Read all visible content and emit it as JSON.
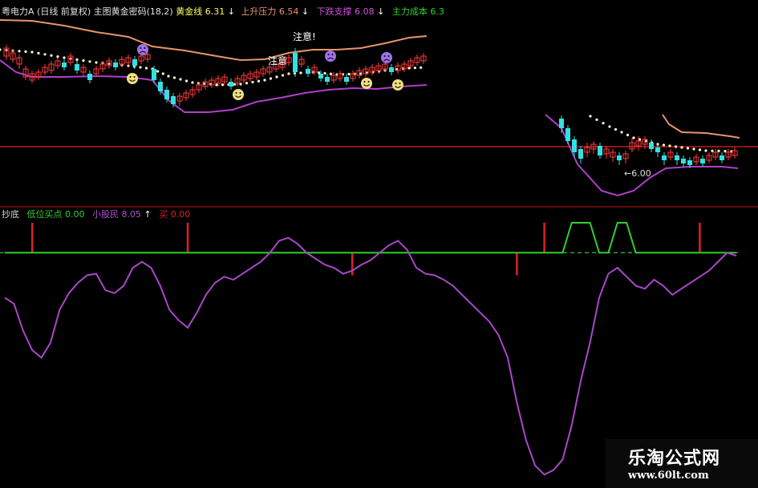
{
  "colors": {
    "background": "#000000",
    "bull_candle": "#ff3b3b",
    "bear_candle": "#33e0e0",
    "upper_band": "#e8956a",
    "lower_band": "#b040c8",
    "mid_dots": "#ffffcc",
    "separator": "#c01818",
    "buy_bar": "#e02020",
    "small_shareholder": "#a848c8",
    "low_buy_line": "#30d030",
    "baseline_dash": "#30c030",
    "watermark_text": "#ffffff",
    "watermark_bg": "#0a0a0a"
  },
  "main_header": {
    "stock": "粤电力A",
    "mode": "(日线 前复权)",
    "indicator": "主图黄金密码(18,2)",
    "golden_line": "黄金线 6.31",
    "golden_arrow": "↓",
    "rise_pressure": "上升压力 6.54",
    "rise_arrow": "↓",
    "fall_support": "下跌支撑 6.08",
    "fall_arrow": "↓",
    "main_cost": "主力成本 6.3"
  },
  "main_annotations": {
    "attention_1": "注意!",
    "attention_2": "注意",
    "price_low": "←6.00"
  },
  "sub_header": {
    "name": "抄底",
    "low_buy": "低位买点 0.00",
    "small_shareholder": "小股民 8.05",
    "small_arrow": "↑",
    "buy": "买 0.00"
  },
  "watermark": {
    "title": "乐淘公式网",
    "url": "www.60lt.com"
  },
  "chart_data": [
    {
      "type": "line",
      "title": "",
      "note": "Price panel (candles with bands); values in CNY read from header",
      "series": [
        {
          "name": "黄金线",
          "last": 6.31
        },
        {
          "name": "上升压力",
          "last": 6.54
        },
        {
          "name": "下跌支撑",
          "last": 6.08
        },
        {
          "name": "主力成本",
          "last": 6.3
        }
      ],
      "annotations": [
        "注意!",
        "注意",
        "←6.00"
      ]
    },
    {
      "type": "line",
      "title": "抄底",
      "series": [
        {
          "name": "小股民",
          "values": [
            50,
            46,
            28,
            15,
            10,
            20,
            42,
            53,
            60,
            65,
            66,
            55,
            53,
            58,
            70,
            74,
            70,
            58,
            42,
            35,
            30,
            40,
            52,
            60,
            64,
            62,
            66,
            70,
            74,
            80,
            88,
            90,
            86,
            80,
            76,
            72,
            70,
            66,
            68,
            72,
            75,
            80,
            85,
            88,
            82,
            70,
            66,
            65,
            62,
            58,
            52,
            46,
            40,
            34,
            25,
            10,
            -20,
            -45,
            -62,
            -68,
            -65,
            -58,
            -35,
            -5,
            20,
            50,
            66,
            70,
            64,
            58,
            56,
            62,
            58,
            52,
            56,
            60,
            64,
            68,
            74,
            80,
            78
          ]
        },
        {
          "name": "低位买点",
          "values": [
            0,
            0,
            0,
            0,
            0,
            0,
            0,
            0,
            0,
            0,
            0,
            0,
            0,
            0,
            0,
            0,
            0,
            0,
            0,
            0,
            0,
            0,
            0,
            0,
            0,
            0,
            0,
            0,
            0,
            0,
            0,
            0,
            0,
            0,
            0,
            0,
            0,
            0,
            0,
            0,
            0,
            0,
            0,
            0,
            0,
            0,
            0,
            0,
            0,
            0,
            0,
            0,
            0,
            0,
            0,
            0,
            0,
            0,
            0,
            0,
            0,
            0,
            100,
            100,
            100,
            0,
            0,
            100,
            100,
            0,
            0,
            0,
            0,
            0,
            0,
            0,
            0,
            0,
            0,
            0,
            0
          ]
        },
        {
          "name": "买",
          "bars_at_index": [
            3,
            20,
            38,
            56,
            59,
            76
          ],
          "values": [
            100,
            100,
            65,
            65,
            100,
            100
          ]
        }
      ],
      "ylim": [
        -70,
        100
      ],
      "baseline": 80
    }
  ]
}
